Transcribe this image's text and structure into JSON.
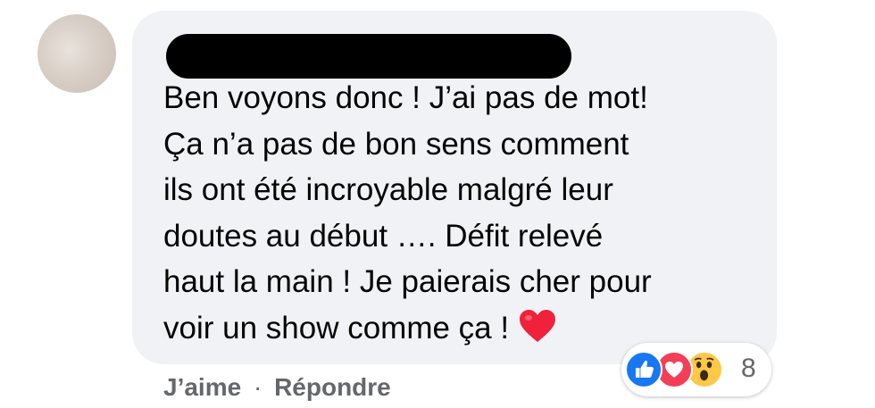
{
  "comment": {
    "lines": [
      "Ben voyons donc ! J’ai pas de mot!",
      "Ça n’a pas de bon sens comment",
      "ils ont été incroyable malgré leur",
      "doutes au début …. Défit relevé",
      "haut la main ! Je paierais cher pour",
      "voir un show comme ça !"
    ],
    "emoji": "heart-icon"
  },
  "reactions": {
    "icons": [
      "like-icon",
      "love-icon",
      "wow-icon"
    ],
    "count": "8"
  },
  "actions": {
    "like_label": "J’aime",
    "separator": "·",
    "reply_label": "Répondre"
  },
  "colors": {
    "bubble": "#f0f2f5",
    "text": "#050505",
    "muted": "#65676b",
    "like": "#1877f2",
    "love": "#f33e58",
    "wow": "#fcc845"
  }
}
